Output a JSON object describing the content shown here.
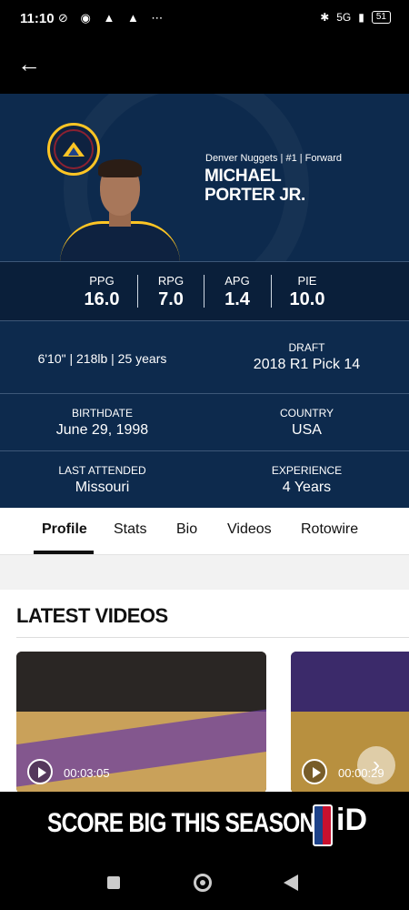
{
  "status_bar": {
    "time": "11:10",
    "left_icons": "⊘ ◉ ▲ ▲ ⋯",
    "network": "5G",
    "battery": "51"
  },
  "profile_header": {
    "team_line": "Denver Nuggets | #1 | Forward",
    "first_name": "MICHAEL",
    "last_name": "PORTER JR."
  },
  "stats": [
    {
      "label": "PPG",
      "value": "16.0"
    },
    {
      "label": "RPG",
      "value": "7.0"
    },
    {
      "label": "APG",
      "value": "1.4"
    },
    {
      "label": "PIE",
      "value": "10.0"
    }
  ],
  "info": {
    "physical": "6'10\" | 218lb | 25 years",
    "draft_label": "DRAFT",
    "draft_value": "2018 R1 Pick 14",
    "birthdate_label": "BIRTHDATE",
    "birthdate_value": "June 29, 1998",
    "country_label": "COUNTRY",
    "country_value": "USA",
    "last_attended_label": "LAST ATTENDED",
    "last_attended_value": "Missouri",
    "experience_label": "EXPERIENCE",
    "experience_value": "4 Years"
  },
  "tabs": [
    {
      "label": "Profile",
      "active": true
    },
    {
      "label": "Stats"
    },
    {
      "label": "Bio"
    },
    {
      "label": "Videos"
    },
    {
      "label": "Rotowire"
    }
  ],
  "latest_videos": {
    "title": "LATEST VIDEOS",
    "items": [
      {
        "duration": "00:03:05"
      },
      {
        "duration": "00:00:29"
      }
    ]
  },
  "ad": {
    "text": "SCORE BIG THIS SEASON",
    "suffix": "iD"
  }
}
